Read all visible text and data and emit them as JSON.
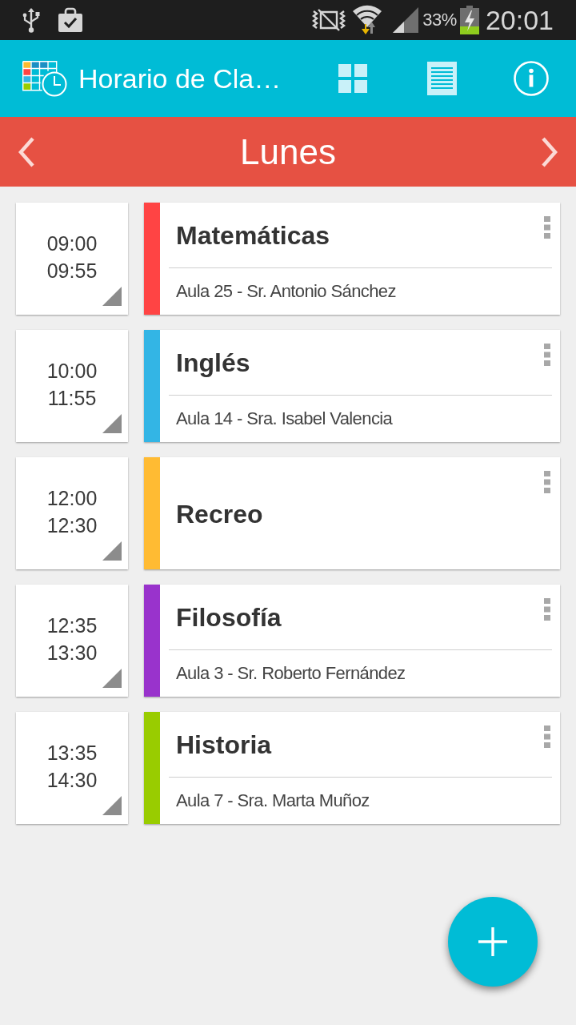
{
  "status_bar": {
    "battery": "33%",
    "time": "20:01"
  },
  "app_bar": {
    "title": "Horario de Cla…"
  },
  "day_bar": {
    "day": "Lunes"
  },
  "classes": [
    {
      "start": "09:00",
      "end": "09:55",
      "name": "Matemáticas",
      "details": "Aula 25 - Sr. Antonio Sánchez",
      "color": "#ff4444"
    },
    {
      "start": "10:00",
      "end": "11:55",
      "name": "Inglés",
      "details": "Aula 14 - Sra. Isabel Valencia",
      "color": "#33b5e5"
    },
    {
      "start": "12:00",
      "end": "12:30",
      "name": "Recreo",
      "color": "#ffbb33"
    },
    {
      "start": "12:35",
      "end": "13:30",
      "name": "Filosofía",
      "details": "Aula 3 - Sr. Roberto Fernández",
      "color": "#9933cc"
    },
    {
      "start": "13:35",
      "end": "14:30",
      "name": "Historia",
      "details": "Aula 7 - Sra. Marta Muñoz",
      "color": "#99cc00"
    }
  ]
}
